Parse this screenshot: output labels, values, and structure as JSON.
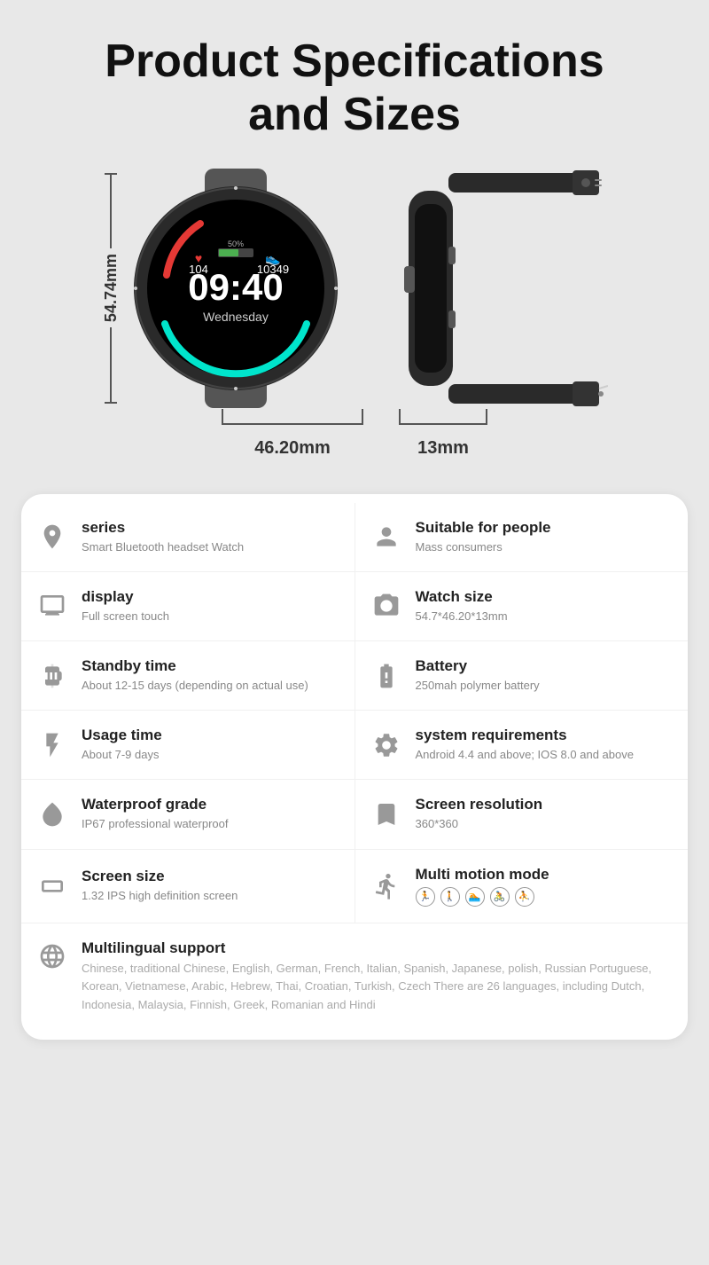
{
  "header": {
    "title_line1": "Product Specifications",
    "title_line2": "and Sizes"
  },
  "dimensions": {
    "height": "54.74mm",
    "width_front": "46.20mm",
    "width_side": "13mm"
  },
  "specs": [
    {
      "left": {
        "icon": "series-icon",
        "label": "series",
        "value": "Smart Bluetooth headset Watch"
      },
      "right": {
        "icon": "people-icon",
        "label": "Suitable for people",
        "value": "Mass consumers"
      }
    },
    {
      "left": {
        "icon": "display-icon",
        "label": "display",
        "value": "Full screen touch"
      },
      "right": {
        "icon": "watch-size-icon",
        "label": "Watch size",
        "value": "54.7*46.20*13mm"
      }
    },
    {
      "left": {
        "icon": "standby-icon",
        "label": "Standby time",
        "value": "About 12-15 days (depending on actual use)"
      },
      "right": {
        "icon": "battery-icon",
        "label": "Battery",
        "value": "250mah polymer battery"
      }
    },
    {
      "left": {
        "icon": "usage-icon",
        "label": "Usage time",
        "value": "About 7-9 days"
      },
      "right": {
        "icon": "system-icon",
        "label": "system requirements",
        "value": "Android 4.4 and above; IOS 8.0 and above"
      }
    },
    {
      "left": {
        "icon": "waterproof-icon",
        "label": "Waterproof grade",
        "value": "IP67 professional waterproof"
      },
      "right": {
        "icon": "resolution-icon",
        "label": "Screen resolution",
        "value": "360*360"
      }
    },
    {
      "left": {
        "icon": "screen-size-icon",
        "label": "Screen size",
        "value": "1.32 IPS high definition screen"
      },
      "right": {
        "icon": "motion-icon",
        "label": "Multi motion mode",
        "value": "motion_icons"
      }
    }
  ],
  "multilingual": {
    "icon": "globe-icon",
    "label": "Multilingual support",
    "value": "Chinese, traditional Chinese, English, German, French, Italian, Spanish, Japanese, polish, Russian Portuguese, Korean, Vietnamese, Arabic, Hebrew, Thai, Croatian, Turkish, Czech There are 26 languages, including Dutch, Indonesia, Malaysia, Finnish, Greek, Romanian and Hindi"
  }
}
